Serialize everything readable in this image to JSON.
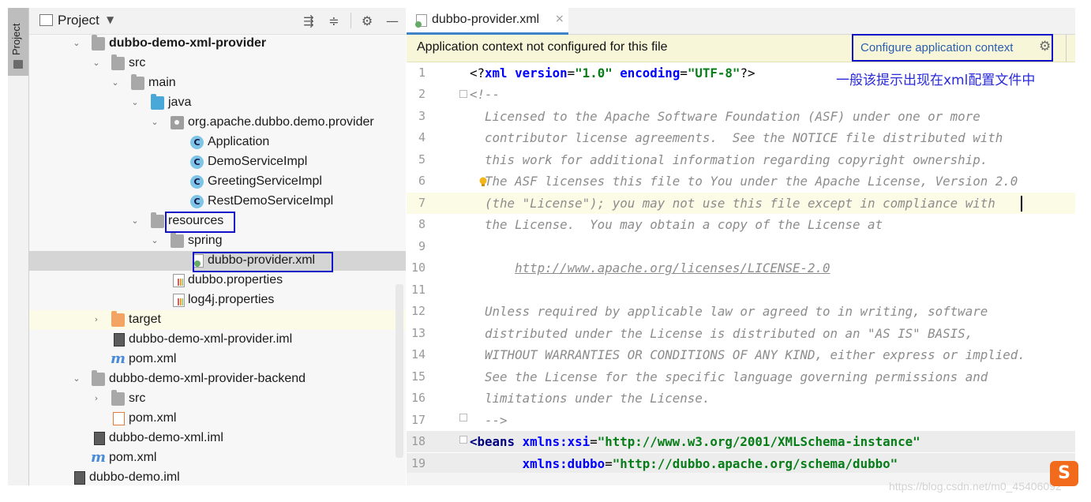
{
  "toolstrip": {
    "project_tab_label": "Project"
  },
  "panel": {
    "title": "Project",
    "tree": [
      {
        "label": "dubbo-demo-xml-provider",
        "bold": true
      },
      {
        "label": "src"
      },
      {
        "label": "main"
      },
      {
        "label": "java"
      },
      {
        "label": "org.apache.dubbo.demo.provider"
      },
      {
        "label": "Application"
      },
      {
        "label": "DemoServiceImpl"
      },
      {
        "label": "GreetingServiceImpl"
      },
      {
        "label": "RestDemoServiceImpl"
      },
      {
        "label": "resources"
      },
      {
        "label": "spring"
      },
      {
        "label": "dubbo-provider.xml"
      },
      {
        "label": "dubbo.properties"
      },
      {
        "label": "log4j.properties"
      },
      {
        "label": "target"
      },
      {
        "label": "dubbo-demo-xml-provider.iml"
      },
      {
        "label": "pom.xml"
      },
      {
        "label": "dubbo-demo-xml-provider-backend"
      },
      {
        "label": "src"
      },
      {
        "label": "pom.xml"
      },
      {
        "label": "dubbo-demo-xml.iml"
      },
      {
        "label": "pom.xml"
      },
      {
        "label": "dubbo-demo.iml"
      }
    ]
  },
  "editor": {
    "tab_label": "dubbo-provider.xml",
    "tab_close": "×",
    "banner_text": "Application context not configured for this file",
    "banner_link": "Configure application context",
    "annotation_note": "一般该提示出现在xml配置文件中",
    "line_numbers": [
      "1",
      "2",
      "3",
      "4",
      "5",
      "6",
      "7",
      "8",
      "9",
      "10",
      "11",
      "12",
      "13",
      "14",
      "15",
      "16",
      "17",
      "18",
      "19"
    ],
    "lines": {
      "l1": {
        "a": "<?",
        "b": "xml version",
        "c": "=",
        "d": "\"1.0\"",
        "e": " encoding",
        "f": "=",
        "g": "\"UTF-8\"",
        "h": "?>"
      },
      "l2": "<!--",
      "l3": "  Licensed to the Apache Software Foundation (ASF) under one or more",
      "l4": "  contributor license agreements.  See the NOTICE file distributed with",
      "l5": "  this work for additional information regarding copyright ownership.",
      "l6": "  The ASF licenses this file to You under the Apache License, Version 2.0",
      "l7": "  (the \"License\"); you may not use this file except in compliance with",
      "l8": "  the License.  You may obtain a copy of the License at",
      "l9": "",
      "l10_pre": "      ",
      "l10_link": "http://www.apache.org/licenses/LICENSE-2.0",
      "l11": "",
      "l12": "  Unless required by applicable law or agreed to in writing, software",
      "l13": "  distributed under the License is distributed on an \"AS IS\" BASIS,",
      "l14": "  WITHOUT WARRANTIES OR CONDITIONS OF ANY KIND, either express or implied.",
      "l15": "  See the License for the specific language governing permissions and",
      "l16": "  limitations under the License.",
      "l17": "  -->",
      "l18": {
        "a": "<beans",
        "b": " xmlns:xsi",
        "c": "=",
        "d": "\"http://www.w3.org/2001/XMLSchema-instance\""
      },
      "l19": {
        "a": "       xmlns:dubbo",
        "b": "=",
        "c": "\"http://dubbo.apache.org/schema/dubbo\""
      }
    }
  },
  "watermark": "https://blog.csdn.net/m0_45406092",
  "sogou_badge": "S"
}
